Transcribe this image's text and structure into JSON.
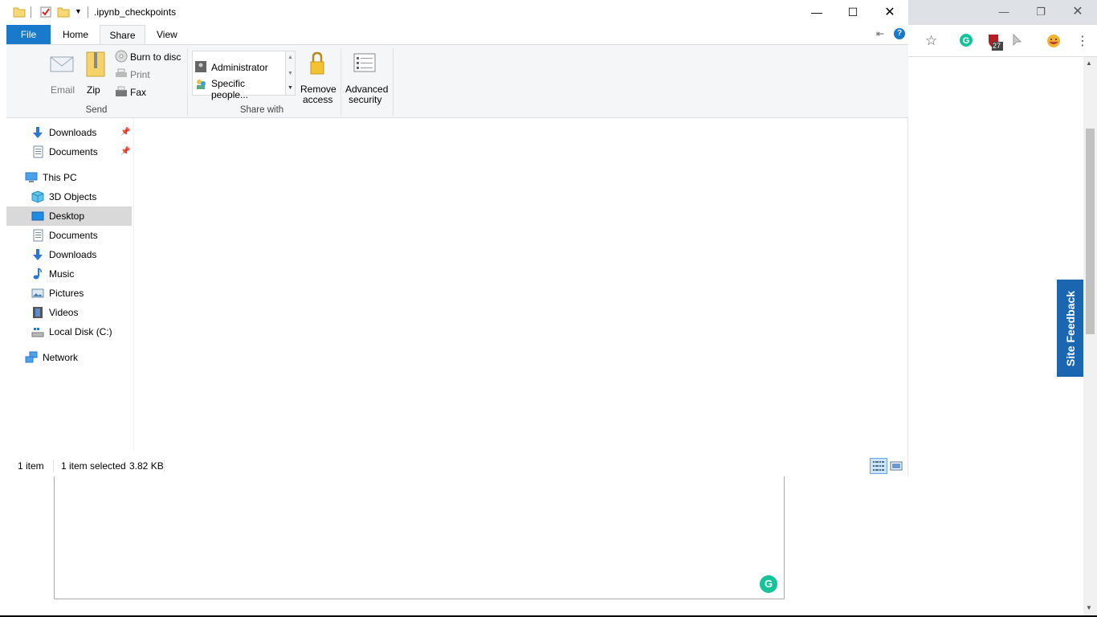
{
  "explorer": {
    "title": ".ipynb_checkpoints",
    "tabs": {
      "file": "File",
      "home": "Home",
      "share": "Share",
      "view": "View"
    },
    "send_group": {
      "label": "Send",
      "email": "Email",
      "zip": "Zip",
      "burn": "Burn to disc",
      "print": "Print",
      "fax": "Fax"
    },
    "share_with_group": {
      "label": "Share with",
      "users": [
        "Administrator",
        "Specific people..."
      ]
    },
    "remove_access": {
      "line1": "Remove",
      "line2": "access"
    },
    "advanced_security": {
      "line1": "Advanced",
      "line2": "security"
    },
    "nav": {
      "quick_access": [
        {
          "label": "Downloads",
          "icon": "download-arrow-icon"
        },
        {
          "label": "Documents",
          "icon": "documents-icon"
        }
      ],
      "this_pc": "This PC",
      "this_pc_items": [
        {
          "label": "3D Objects",
          "icon": "cube-icon"
        },
        {
          "label": "Desktop",
          "icon": "desktop-icon",
          "selected": true
        },
        {
          "label": "Documents",
          "icon": "documents-icon"
        },
        {
          "label": "Downloads",
          "icon": "download-arrow-icon"
        },
        {
          "label": "Music",
          "icon": "music-note-icon"
        },
        {
          "label": "Pictures",
          "icon": "pictures-icon"
        },
        {
          "label": "Videos",
          "icon": "videos-icon"
        },
        {
          "label": "Local Disk (C:)",
          "icon": "drive-icon"
        }
      ],
      "network": "Network"
    },
    "status": {
      "items": "1 item",
      "selected": "1 item selected",
      "size": "3.82 KB"
    }
  },
  "browser": {
    "extension_badge": "27",
    "site_feedback": "Site Feedback"
  },
  "colors": {
    "file_tab": "#1979ca",
    "selection": "#d9d9d9",
    "site_feedback": "#1b66b1",
    "grammarly": "#15c39a"
  }
}
